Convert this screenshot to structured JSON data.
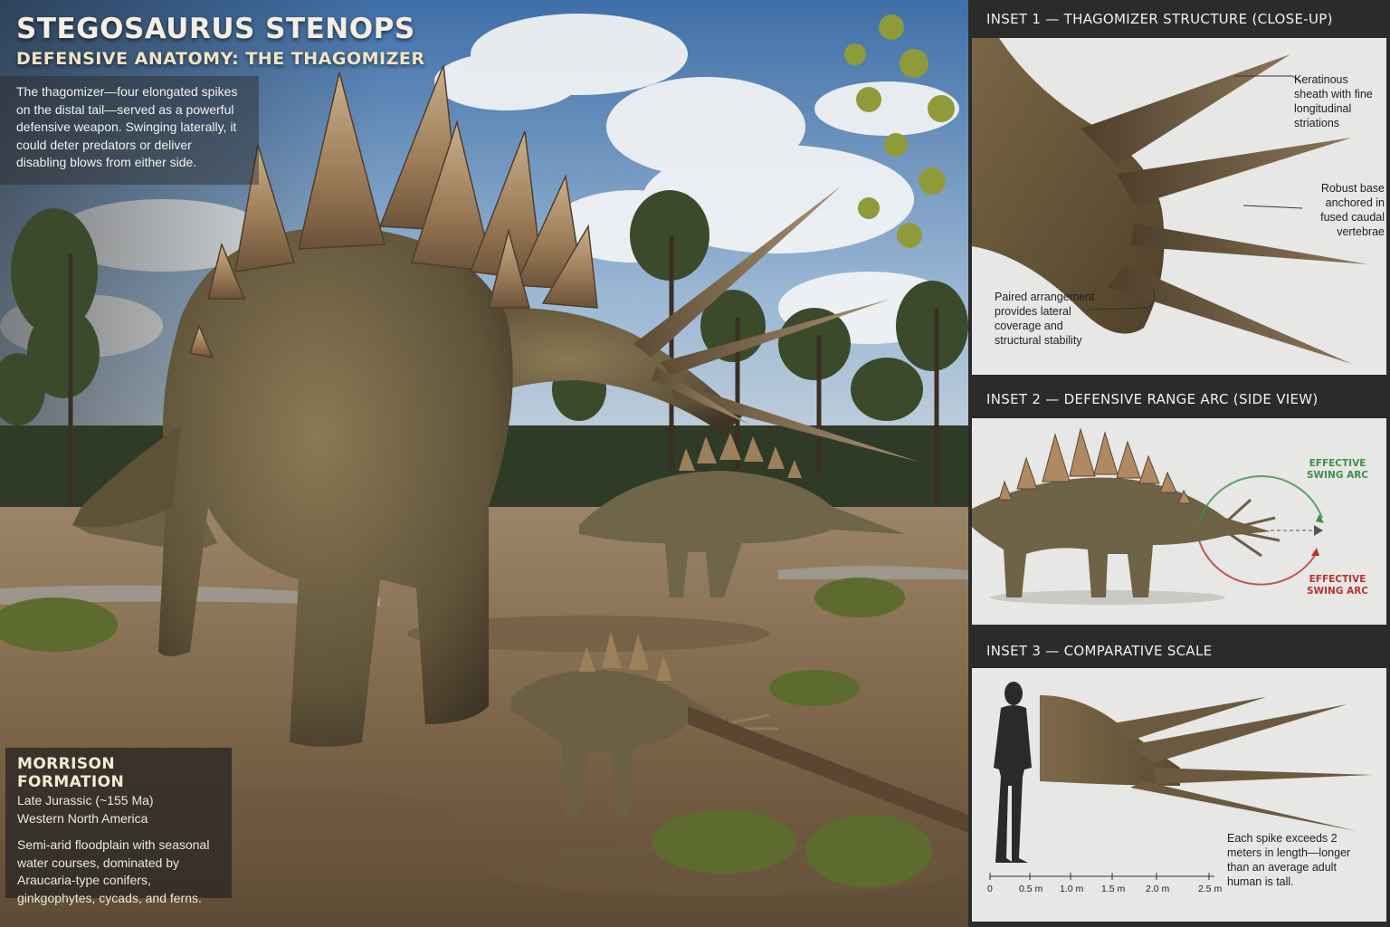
{
  "header": {
    "title": "STEGOSAURUS STENOPS",
    "subtitle": "DEFENSIVE ANATOMY: THE THAGOMIZER"
  },
  "intro": {
    "text": "The thagomizer—four elongated spikes on the distal tail—served as a powerful defensive weapon. Swinging laterally, it could deter predators or deliver disabling blows from either side."
  },
  "formation": {
    "title": "MORRISON FORMATION",
    "age": "Late Jurassic (~155 Ma)",
    "region": "Western North America",
    "description": "Semi-arid floodplain with seasonal water courses, dominated by Araucaria-type conifers, ginkgophytes, cycads, and ferns."
  },
  "inset1": {
    "title": "INSET 1 — THAGOMIZER STRUCTURE (CLOSE-UP)",
    "note_sheath": "Keratinous sheath with fine longitudinal striations",
    "note_base": "Robust base anchored in fused caudal vertebrae",
    "note_paired": "Paired arrangement provides lateral coverage and structural stability"
  },
  "inset2": {
    "title": "INSET 2 — DEFENSIVE RANGE ARC (SIDE VIEW)",
    "arc_top": "EFFECTIVE SWING ARC",
    "arc_bottom": "EFFECTIVE SWING ARC"
  },
  "inset3": {
    "title": "INSET 3 — COMPARATIVE SCALE",
    "note": "Each spike exceeds 2 meters in length—longer than an average adult human is tall.",
    "scale_ticks": [
      "0",
      "0.5 m",
      "1.0 m",
      "1.5 m",
      "2.0 m",
      "2.5 m"
    ]
  },
  "colors": {
    "arc_green": "#3f8f4a",
    "arc_red": "#b8332f",
    "panel_bg": "#e7e7e5",
    "header_bg": "#2b2b2b"
  }
}
